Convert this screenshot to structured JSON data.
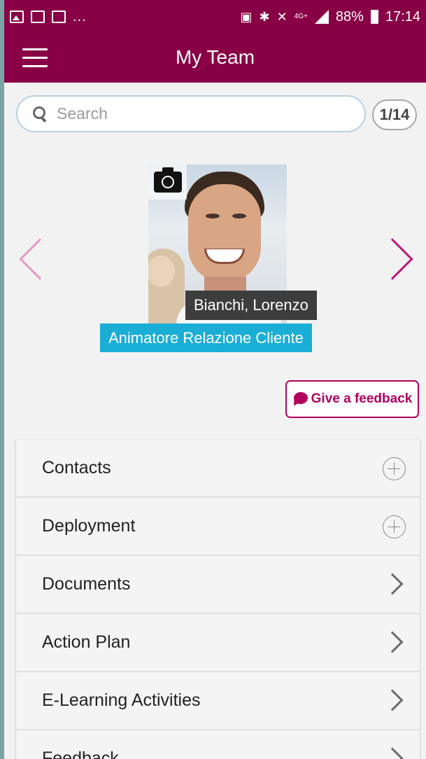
{
  "status_bar": {
    "overflow": "...",
    "network": "4G+",
    "battery": "88%",
    "time": "17:14"
  },
  "app_bar": {
    "title": "My Team"
  },
  "search": {
    "placeholder": "Search",
    "value": ""
  },
  "pager": {
    "text": "1/14"
  },
  "profile": {
    "name": "Bianchi, Lorenzo",
    "role": "Animatore Relazione Cliente"
  },
  "feedback_button": {
    "label": "Give a feedback"
  },
  "menu": {
    "items": [
      {
        "label": "Contacts",
        "icon": "plus-circle-icon"
      },
      {
        "label": "Deployment",
        "icon": "plus-circle-icon"
      },
      {
        "label": "Documents",
        "icon": "chevron-right-icon"
      },
      {
        "label": "Action Plan",
        "icon": "chevron-right-icon"
      },
      {
        "label": "E-Learning Activities",
        "icon": "chevron-right-icon"
      },
      {
        "label": "Feedback",
        "icon": "chevron-right-icon"
      }
    ]
  },
  "colors": {
    "brand": "#880045",
    "accent": "#b3005f",
    "role_tag": "#1aaed6",
    "name_tag": "#3d3d3d"
  }
}
